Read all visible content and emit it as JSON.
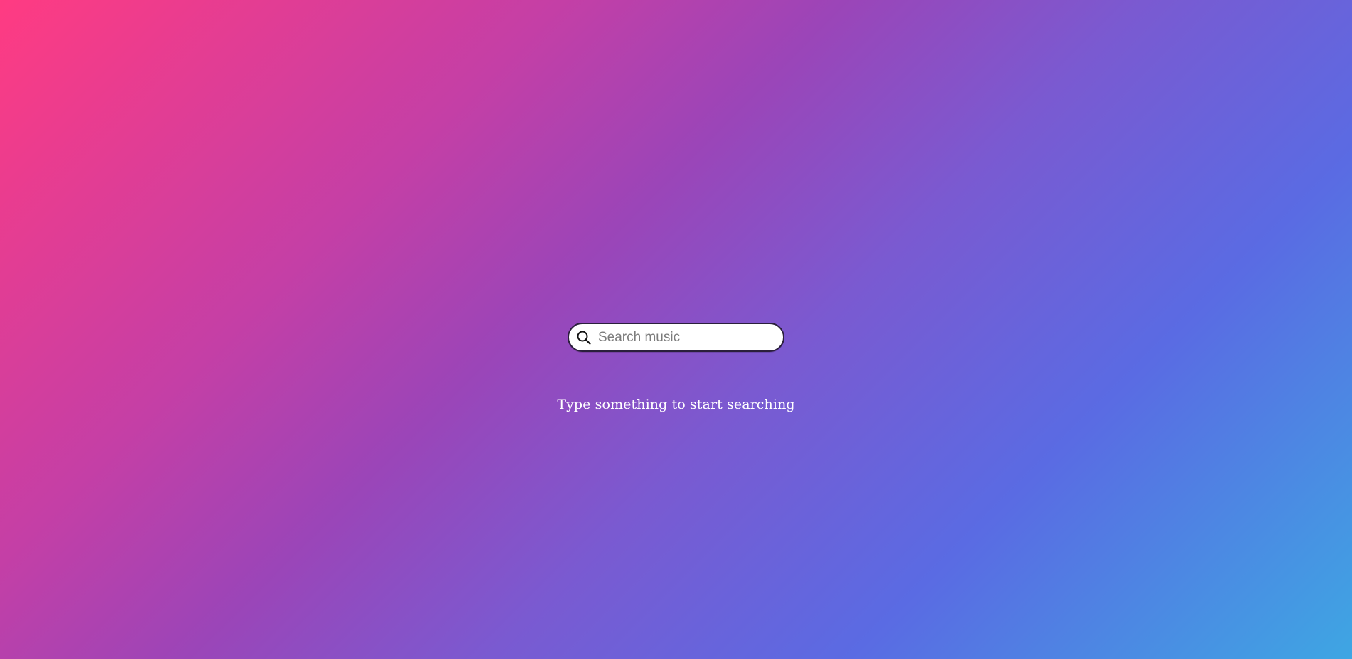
{
  "search": {
    "placeholder": "Search music",
    "value": "",
    "icon": "search-icon"
  },
  "empty_state": {
    "message": "Type something to start searching"
  },
  "colors": {
    "gradient_start": "#ff3b82",
    "gradient_mid": "#9b45b8",
    "gradient_end": "#3ea6e3",
    "input_border": "#2b1f3c",
    "hint_text": "#ffffff"
  }
}
